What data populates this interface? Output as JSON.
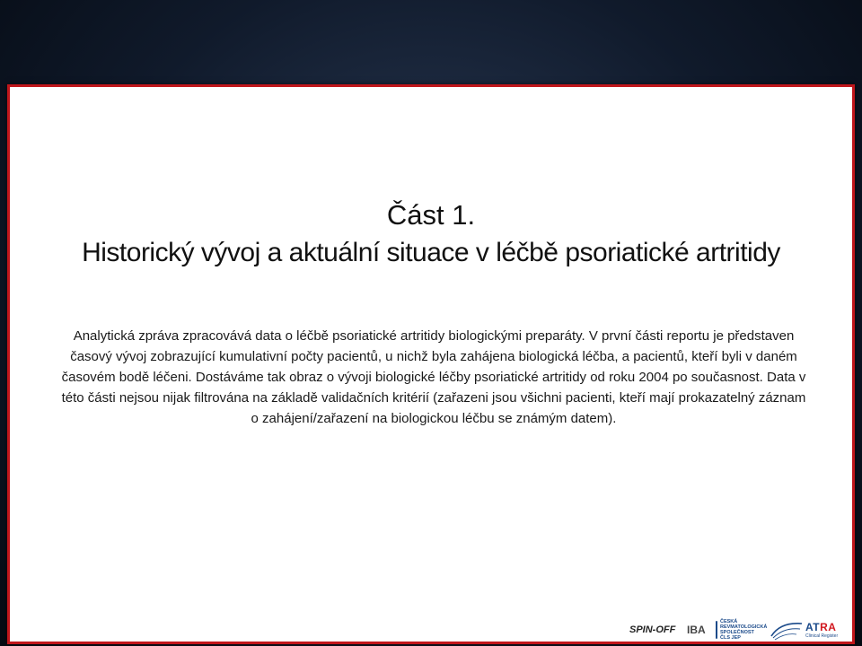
{
  "slide": {
    "title_line1": "Část 1.",
    "title_line2": "Historický vývoj a aktuální situace v léčbě psoriatické artritidy",
    "paragraph": "Analytická zpráva zpracovává data o léčbě psoriatické artritidy biologickými preparáty. V první části reportu je představen časový vývoj zobrazující kumulativní počty pacientů, u nichž byla zahájena biologická léčba, a pacientů, kteří byli v daném časovém bodě léčeni. Dostáváme tak obraz o vývoji biologické léčby psoriatické artritidy od roku 2004 po současnost. Data v této části nejsou nijak filtrována na základě validačních kritérií (zařazeni jsou všichni pacienti, kteří mají prokazatelný záznam o zahájení/zařazení na biologickou léčbu se známým datem)."
  },
  "logos": {
    "spinoff": "SPIN-OFF",
    "iba": "IBA",
    "crs": [
      "ČESKÁ",
      "REVMATOLOGICKÁ",
      "SPOLEČNOST",
      "ČLS JEP"
    ],
    "attra_prefix": "AT",
    "attra_suffix": "RA",
    "attra_sub": "Clinical Register"
  },
  "colors": {
    "background": "#101a2b",
    "slide_border": "#c0161b",
    "text": "#111111",
    "accent_red": "#d1181f",
    "accent_blue": "#1b4a8a"
  }
}
